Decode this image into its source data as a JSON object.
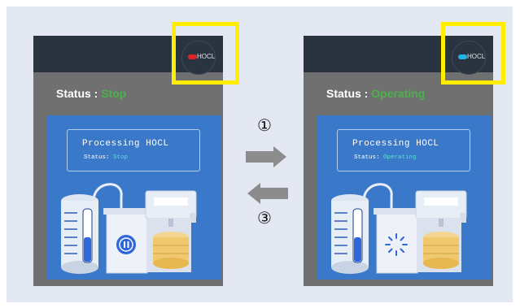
{
  "panels": [
    {
      "logo_text": "HOCL",
      "logo_indicator_color": "#e0242a",
      "status_label": "Status : ",
      "status_value": "Stop",
      "screen_title": "Processing HOCL",
      "screen_status_label": "Status: ",
      "screen_status_value": "Stop",
      "device_icon": "pause-icon"
    },
    {
      "logo_text": "HOCL",
      "logo_indicator_color": "#1fb4e8",
      "status_label": "Status : ",
      "status_value": "Operating",
      "screen_title": "Processing HOCL",
      "screen_status_label": "Status: ",
      "screen_status_value": "Operating",
      "device_icon": "spinner-icon"
    }
  ],
  "steps": {
    "forward": "①",
    "back": "③"
  },
  "colors": {
    "highlight": "#ffee00",
    "status_green": "#4cb14c",
    "screen_blue": "#3a78c9",
    "arrow_gray": "#8c8c8c"
  }
}
